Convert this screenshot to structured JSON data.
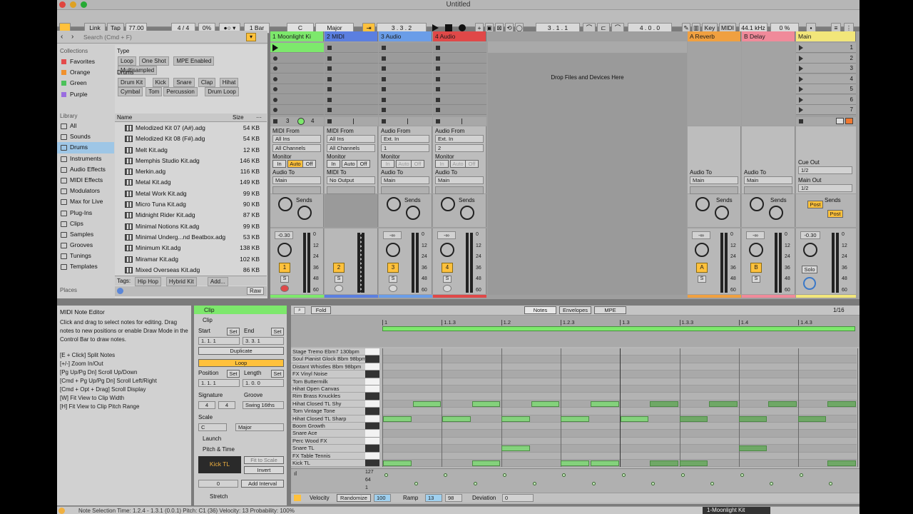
{
  "window": {
    "title": "Untitled"
  },
  "transport": {
    "link": "Link",
    "tap": "Tap",
    "tempo": "77.00",
    "signature": "4 / 4",
    "swing": "0%",
    "quantize": "1 Bar",
    "key_root": "C",
    "key_scale": "Major",
    "arrangement_position": "3 .   3 .   2",
    "loop_start": "3 .   1 .   1",
    "loop_length": "4 .   0 .   0",
    "key_label": "Key",
    "midi_label": "MIDI",
    "sample_rate": "44.1 kHz",
    "cpu": "0 %"
  },
  "browser": {
    "search_placeholder": "Search (Cmd + F)",
    "collections_header": "Collections",
    "collections": [
      {
        "label": "Favorites",
        "color": "#e34b4b"
      },
      {
        "label": "Orange",
        "color": "#f0912e"
      },
      {
        "label": "Green",
        "color": "#4cc25a"
      },
      {
        "label": "Purple",
        "color": "#9a6de0"
      }
    ],
    "library_header": "Library",
    "library": [
      "All",
      "Sounds",
      "Drums",
      "Instruments",
      "Audio Effects",
      "MIDI Effects",
      "Modulators",
      "Max for Live",
      "Plug-Ins",
      "Clips",
      "Samples",
      "Grooves",
      "Tunings",
      "Templates"
    ],
    "places_header": "Places",
    "places": [
      "Packs"
    ],
    "filter_type_label": "Type",
    "filter_type_tags": [
      "Loop",
      "One Shot",
      "MPE Enabled",
      "Multisampled"
    ],
    "filter_drums_label": "Drums",
    "filter_drums_tags": [
      "Drum Kit",
      "Kick",
      "Snare",
      "Clap",
      "Hihat",
      "Cymbal",
      "Tom",
      "Percussion",
      "Drum Loop"
    ],
    "col_name": "Name",
    "col_size": "Size",
    "files": [
      {
        "name": "Melodized Kit 07 (A#).adg",
        "size": "54 KB"
      },
      {
        "name": "Melodized Kit 08 (F#).adg",
        "size": "54 KB"
      },
      {
        "name": "Melt Kit.adg",
        "size": "12 KB"
      },
      {
        "name": "Memphis Studio Kit.adg",
        "size": "146 KB"
      },
      {
        "name": "Merkin.adg",
        "size": "116 KB"
      },
      {
        "name": "Metal Kit.adg",
        "size": "149 KB"
      },
      {
        "name": "Metal Work Kit.adg",
        "size": "99 KB"
      },
      {
        "name": "Micro Tuna Kit.adg",
        "size": "90 KB"
      },
      {
        "name": "Midnight Rider Kit.adg",
        "size": "87 KB"
      },
      {
        "name": "Minimal Notions Kit.adg",
        "size": "99 KB"
      },
      {
        "name": "Minimal Underg...nd Beatbox.adg",
        "size": "53 KB"
      },
      {
        "name": "Minimum Kit.adg",
        "size": "138 KB"
      },
      {
        "name": "Miramar Kit.adg",
        "size": "102 KB"
      },
      {
        "name": "Mixed Overseas Kit.adg",
        "size": "86 KB"
      }
    ],
    "tags_label": "Tags:",
    "tags": [
      "Hip Hop",
      "Hybrid Kit",
      "Add..."
    ],
    "raw_label": "Raw"
  },
  "tracks": [
    {
      "name": "1 Moonlight Ki",
      "color": "#7de86c",
      "from_label": "MIDI From",
      "from": "All Ins",
      "channel": "All Channels",
      "monitor_label": "Monitor",
      "to_label": "Audio To",
      "to": "Main",
      "vol": "-0.30",
      "num": "1",
      "sends": "Sends"
    },
    {
      "name": "2 MIDI",
      "color": "#5b7fe0",
      "from_label": "MIDI From",
      "from": "All Ins",
      "channel": "All Channels",
      "monitor_label": "Monitor",
      "to_label": "MIDI To",
      "to": "No Output",
      "vol": "",
      "num": "2",
      "sends": ""
    },
    {
      "name": "3 Audio",
      "color": "#6a9de8",
      "from_label": "Audio From",
      "from": "Ext. In",
      "channel": "1",
      "monitor_label": "Monitor",
      "to_label": "Audio To",
      "to": "Main",
      "vol": "-∞",
      "num": "3",
      "sends": "Sends"
    },
    {
      "name": "4 Audio",
      "color": "#e04848",
      "from_label": "Audio From",
      "from": "Ext. In",
      "channel": "2",
      "monitor_label": "Monitor",
      "to_label": "Audio To",
      "to": "Main",
      "vol": "-∞",
      "num": "4",
      "sends": "Sends"
    }
  ],
  "returns": [
    {
      "name": "A Reverb",
      "color": "#f0a040",
      "to_label": "Audio To",
      "to": "Main",
      "vol": "-∞",
      "letter": "A",
      "sends": "Sends"
    },
    {
      "name": "B Delay",
      "color": "#f08a9a",
      "to_label": "Audio To",
      "to": "Main",
      "vol": "-∞",
      "letter": "B",
      "sends": "Sends"
    }
  ],
  "main_track": {
    "name": "Main",
    "color": "#f2e67a",
    "scenes": [
      "1",
      "2",
      "3",
      "4",
      "5",
      "6",
      "7"
    ],
    "cue_out_label": "Cue Out",
    "cue_out": "1/2",
    "main_out_label": "Main Out",
    "main_out": "1/2",
    "vol": "-0.30",
    "solo": "Solo",
    "post": "Post",
    "sends": "Sends"
  },
  "monitor_states": {
    "in": "In",
    "auto": "Auto",
    "off": "Off"
  },
  "drop_zone": "Drop Files and Devices Here",
  "meter_scale": [
    "0",
    "12",
    "24",
    "36",
    "48",
    "60"
  ],
  "stop_row": {
    "scene_count_left": "3",
    "scene_count_right": "4"
  },
  "help": {
    "title": "MIDI Note Editor",
    "body": "Click and drag to select notes for editing. Drag notes to new positions or enable Draw Mode in the Control Bar to draw notes.",
    "shortcuts": [
      "[E + Click] Split Notes",
      "[+/-] Zoom In/Out",
      "[Pg Up/Pg Dn] Scroll Up/Down",
      "[Cmd + Pg Up/Pg Dn] Scroll Left/Right",
      "[Cmd + Opt + Drag] Scroll Display",
      "[W] Fit View to Clip Width",
      "[H] Fit View to Clip Pitch Range"
    ]
  },
  "clip": {
    "header": "Clip",
    "section": "Clip",
    "start_label": "Start",
    "set": "Set",
    "end_label": "End",
    "start": "1.   1.   1",
    "end": "3.   3.   1",
    "duplicate": "Duplicate",
    "loop": "Loop",
    "position_label": "Position",
    "length_label": "Length",
    "position": "1.   1.   1",
    "length": "1.   0.   0",
    "signature_label": "Signature",
    "groove_label": "Groove",
    "sig_num": "4",
    "sig_den": "4",
    "groove": "Swing 16ths",
    "scale_label": "Scale",
    "scale_root": "C",
    "scale_name": "Major",
    "launch": "Launch",
    "pitch_time": "Pitch & Time",
    "note_name": "Kick TL",
    "fit_to_scale": "Fit to Scale",
    "invert": "Invert",
    "transpose": "0",
    "add_interval": "Add Interval",
    "stretch": "Stretch"
  },
  "editor": {
    "fold": "Fold",
    "tabs": [
      "Notes",
      "Envelopes",
      "MPE"
    ],
    "grid": "1/16",
    "ruler": [
      "1",
      "1.1.3",
      "1.2",
      "1.2.3",
      "1.3",
      "1.3.3",
      "1.4",
      "1.4.3"
    ],
    "lanes": [
      "Stage Tremo Ebm7 130bpm",
      "Soul Pianist Glock Bbm 98bpm",
      "Distant Whistles Bbm 98bpm",
      "FX Vinyl Noise",
      "Tom Buttermilk",
      "Hihat Open Canvas",
      "Rim Brass Knuckles",
      "Hihat Closed TL Shy",
      "Tom Vintage Tone",
      "Hihat Closed TL Sharp",
      "Boom Growth",
      "Snare Ace",
      "Perc Wood FX",
      "Snare TL",
      "FX Table Tennis",
      "Kick TL"
    ],
    "velocity_scale": [
      "127",
      "64",
      "1"
    ],
    "footer": {
      "velocity_label": "Velocity",
      "randomize": "Randomize",
      "velocity": "100",
      "ramp_label": "Ramp",
      "ramp_a": "13",
      "ramp_b": "98",
      "deviation_label": "Deviation",
      "deviation": "0"
    }
  },
  "status": {
    "text": "Note Selection   Time: 1.2.4 - 1.3.1 (0.0.1)   Pitch: C1 (36)   Velocity: 13   Probability: 100%",
    "track": "1-Moonlight Kit"
  }
}
